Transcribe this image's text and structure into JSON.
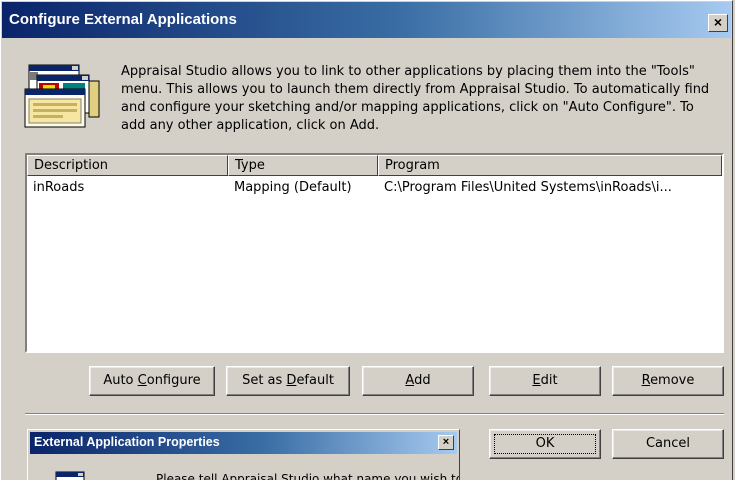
{
  "dialog": {
    "title": "Configure External Applications",
    "close_label": "×",
    "intro_text": "Appraisal Studio allows you to link to other applications by placing them into the \"Tools\" menu.  This allows you to launch them directly from Appraisal Studio.  To automatically find and configure your sketching and/or mapping applications, click on \"Auto Configure\".  To add any other application, click on Add."
  },
  "list": {
    "columns": [
      "Description",
      "Type",
      "Program"
    ],
    "rows": [
      {
        "description": "inRoads",
        "type": "Mapping (Default)",
        "program": "C:\\Program Files\\United Systems\\inRoads\\i..."
      }
    ]
  },
  "buttons": {
    "auto_configure": {
      "pre": "Auto ",
      "key": "C",
      "post": "onfigure"
    },
    "set_default": {
      "pre": "Set as ",
      "key": "D",
      "post": "efault"
    },
    "add": {
      "pre": "",
      "key": "A",
      "post": "dd"
    },
    "edit": {
      "pre": "",
      "key": "E",
      "post": "dit"
    },
    "remove": {
      "pre": "",
      "key": "R",
      "post": "emove"
    },
    "ok": "OK",
    "cancel": "Cancel"
  },
  "subwindow": {
    "title": "External Application Properties",
    "close_label": "×",
    "text": "Please tell Appraisal Studio what name you wish to"
  }
}
